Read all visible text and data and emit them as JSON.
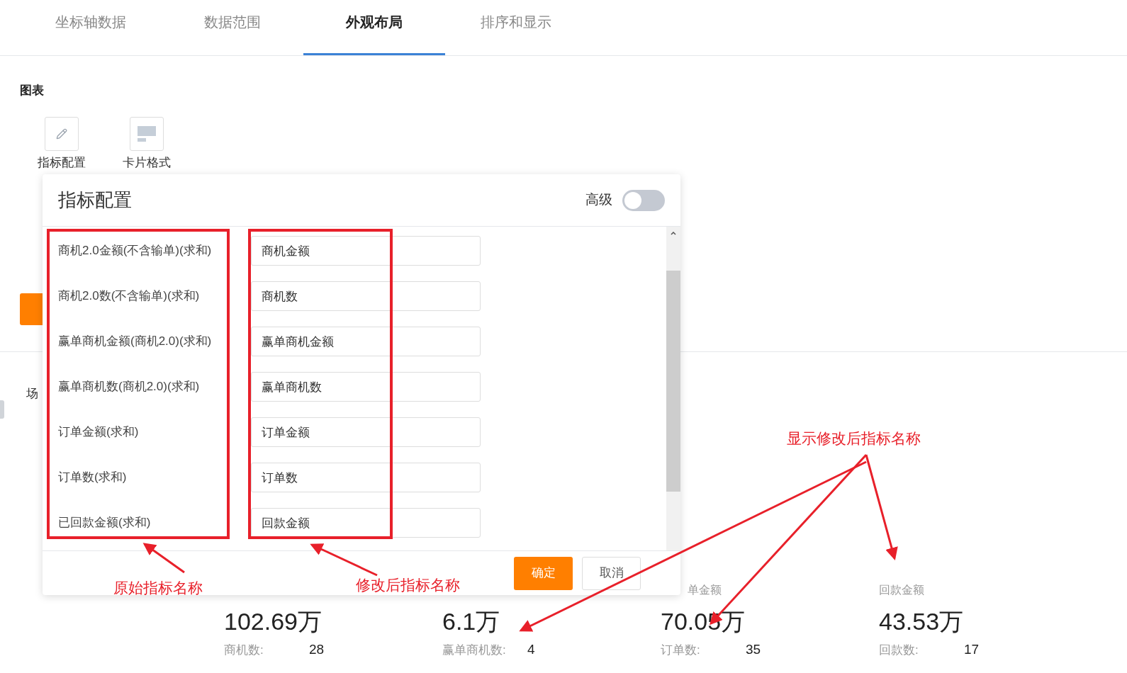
{
  "tabs": [
    {
      "label": "坐标轴数据",
      "selected": false
    },
    {
      "label": "数据范围",
      "selected": false
    },
    {
      "label": "外观布局",
      "selected": true
    },
    {
      "label": "排序和显示",
      "selected": false
    }
  ],
  "section": {
    "title": "图表",
    "options": [
      {
        "label": "指标配置",
        "kind": "edit"
      },
      {
        "label": "卡片格式",
        "kind": "card"
      }
    ]
  },
  "scene_label": "场",
  "dialog": {
    "title": "指标配置",
    "advanced": {
      "label": "高级",
      "on": false
    },
    "rows": [
      {
        "original": "商机2.0金额(不含输单)(求和)",
        "renamed": "商机金额"
      },
      {
        "original": "商机2.0数(不含输单)(求和)",
        "renamed": "商机数"
      },
      {
        "original": "赢单商机金额(商机2.0)(求和)",
        "renamed": "赢单商机金额"
      },
      {
        "original": "赢单商机数(商机2.0)(求和)",
        "renamed": "赢单商机数"
      },
      {
        "original": "订单金额(求和)",
        "renamed": "订单金额"
      },
      {
        "original": "订单数(求和)",
        "renamed": "订单数"
      },
      {
        "original": "已回款金额(求和)",
        "renamed": "回款金额"
      }
    ],
    "confirm": "确定",
    "cancel": "取消"
  },
  "stats": [
    {
      "value": "102.69万",
      "sub_label": "商机数:",
      "sub_value": "28"
    },
    {
      "value": "6.1万",
      "sub_label": "赢单商机数:",
      "sub_value": "4"
    },
    {
      "title": "单金额",
      "value": "70.05万",
      "sub_label": "订单数:",
      "sub_value": "35"
    },
    {
      "title": "回款金额",
      "value": "43.53万",
      "sub_label": "回款数:",
      "sub_value": "17"
    }
  ],
  "annotations": {
    "original_label": "原始指标名称",
    "renamed_label": "修改后指标名称",
    "display_label": "显示修改后指标名称"
  }
}
